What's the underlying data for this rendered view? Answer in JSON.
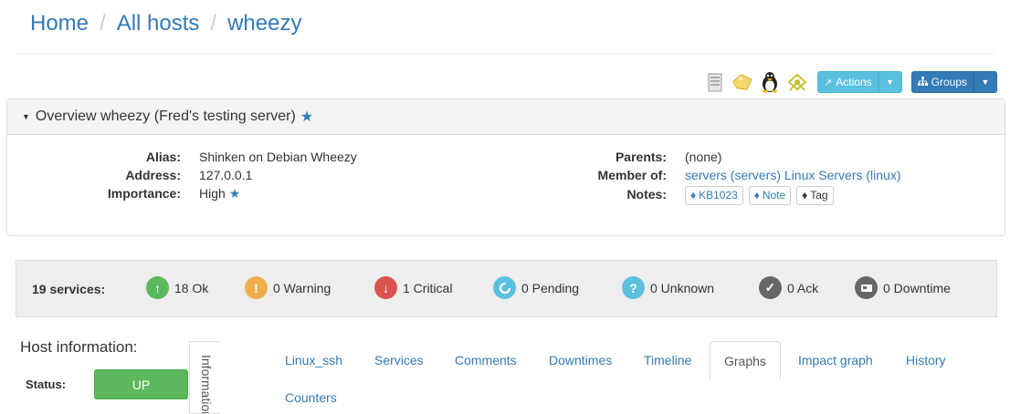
{
  "breadcrumb": [
    {
      "label": "Home"
    },
    {
      "label": "All hosts"
    },
    {
      "label": "wheezy"
    }
  ],
  "toolbar": {
    "actions_label": "Actions",
    "groups_label": "Groups",
    "icons": [
      "server-icon",
      "tag-icon",
      "linux-penguin-icon",
      "plugin-icon"
    ]
  },
  "overview": {
    "title": "Overview wheezy (Fred's testing server)",
    "alias_label": "Alias:",
    "alias_value": "Shinken on Debian Wheezy",
    "address_label": "Address:",
    "address_value": "127.0.0.1",
    "importance_label": "Importance:",
    "importance_value": "High",
    "parents_label": "Parents:",
    "parents_value": "(none)",
    "member_label": "Member of:",
    "member_groups": [
      "servers (servers)",
      "Linux Servers (linux)"
    ],
    "notes_label": "Notes:",
    "notes": [
      "KB1023",
      "Note",
      "Tag"
    ]
  },
  "services": {
    "title": "19 services:",
    "items": [
      {
        "label": "18 Ok",
        "color": "#5cb85c",
        "icon": "arrow-up-icon"
      },
      {
        "label": "0 Warning",
        "color": "#f0ad4e",
        "icon": "exclamation-icon"
      },
      {
        "label": "1 Critical",
        "color": "#d9534f",
        "icon": "arrow-down-icon"
      },
      {
        "label": "0 Pending",
        "color": "#5bc0de",
        "icon": "pending-icon"
      },
      {
        "label": "0 Unknown",
        "color": "#5bc0de",
        "icon": "question-icon"
      },
      {
        "label": "0 Ack",
        "color": "#666666",
        "icon": "check-icon"
      },
      {
        "label": "0 Downtime",
        "color": "#666666",
        "icon": "downtime-icon"
      }
    ]
  },
  "host_info": {
    "title": "Host information:",
    "status_label": "Status:",
    "status_value": "UP",
    "vertical_tab": "Information"
  },
  "tabs": [
    "Linux_ssh",
    "Services",
    "Comments",
    "Downtimes",
    "Timeline",
    "Graphs",
    "Impact graph",
    "History",
    "Counters"
  ],
  "active_tab": "Graphs"
}
